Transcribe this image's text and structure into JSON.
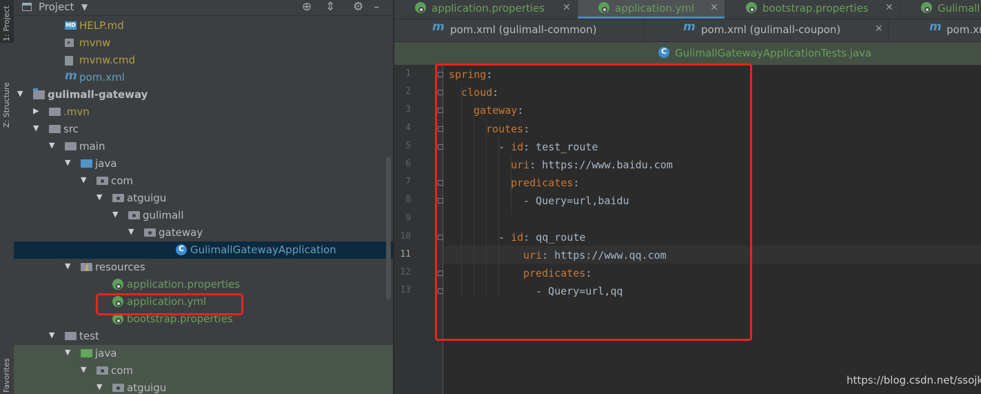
{
  "sidebar_tabs": {
    "project": "1: Project",
    "structure": "Z: Structure",
    "favorites": "Favorites"
  },
  "project_panel": {
    "title": "Project",
    "tree": [
      {
        "label": "HELP.md",
        "icon": "markdown-file-icon",
        "color": "olive"
      },
      {
        "label": "mvnw",
        "icon": "terminal-file-icon",
        "color": "olive"
      },
      {
        "label": "mvnw.cmd",
        "icon": "text-file-icon",
        "color": "olive"
      },
      {
        "label": "pom.xml",
        "icon": "maven-icon",
        "color": "teal"
      },
      {
        "label": "gulimall-gateway",
        "icon": "module-folder-icon",
        "color": "gray"
      },
      {
        "label": ".mvn",
        "icon": "folder-icon",
        "color": "olive"
      },
      {
        "label": "src",
        "icon": "folder-icon",
        "color": "gray"
      },
      {
        "label": "main",
        "icon": "folder-icon",
        "color": "gray"
      },
      {
        "label": "java",
        "icon": "source-folder-icon",
        "color": "gray"
      },
      {
        "label": "com",
        "icon": "package-icon",
        "color": "gray"
      },
      {
        "label": "atguigu",
        "icon": "package-icon",
        "color": "gray"
      },
      {
        "label": "gulimall",
        "icon": "package-icon",
        "color": "gray"
      },
      {
        "label": "gateway",
        "icon": "package-icon",
        "color": "gray"
      },
      {
        "label": "GulimallGatewayApplication",
        "icon": "spring-boot-class-icon",
        "color": "teal"
      },
      {
        "label": "resources",
        "icon": "resources-folder-icon",
        "color": "gray"
      },
      {
        "label": "application.properties",
        "icon": "spring-config-icon",
        "color": "green"
      },
      {
        "label": "application.yml",
        "icon": "spring-config-icon",
        "color": "green"
      },
      {
        "label": "bootstrap.properties",
        "icon": "spring-config-icon",
        "color": "green"
      },
      {
        "label": "test",
        "icon": "folder-icon",
        "color": "gray"
      },
      {
        "label": "java",
        "icon": "test-source-folder-icon",
        "color": "gray"
      },
      {
        "label": "com",
        "icon": "package-icon",
        "color": "gray"
      },
      {
        "label": "atguigu",
        "icon": "package-icon",
        "color": "gray"
      }
    ]
  },
  "tabs_row1": [
    "application.properties",
    "application.yml",
    "bootstrap.properties",
    "Gulimall"
  ],
  "tabs_row2": [
    "pom.xml (gulimall-common)",
    "pom.xml (gulimall-coupon)",
    "pom.xn"
  ],
  "tabs_row3": [
    "GulimallGatewayApplicationTests.java"
  ],
  "editor": {
    "current_line": 11,
    "lines": [
      {
        "n": "1",
        "key": "spring",
        "val": ""
      },
      {
        "n": "2",
        "key": "cloud",
        "val": ""
      },
      {
        "n": "3",
        "key": "gateway",
        "val": ""
      },
      {
        "n": "4",
        "key": "routes",
        "val": ""
      },
      {
        "n": "5",
        "dash": "- ",
        "key": "id",
        "val": "test_route"
      },
      {
        "n": "6",
        "key": "uri",
        "val": "https://www.baidu.com"
      },
      {
        "n": "7",
        "key": "predicates",
        "val": ""
      },
      {
        "n": "8",
        "text": "- Query=url,baidu"
      },
      {
        "n": "9",
        "text": ""
      },
      {
        "n": "10",
        "dash": "- ",
        "key": "id",
        "val": "qq_route"
      },
      {
        "n": "11",
        "key": "uri",
        "val": "https://www.qq.com"
      },
      {
        "n": "12",
        "key": "predicates",
        "val": ""
      },
      {
        "n": "13",
        "text": "- Query=url,qq"
      }
    ]
  },
  "watermark": "https://blog.csdn.net/ssojkl",
  "colors": {
    "highlight_box": "#e8251c",
    "key": "#cc7832",
    "active_tab_underline": "#4a88c7"
  }
}
